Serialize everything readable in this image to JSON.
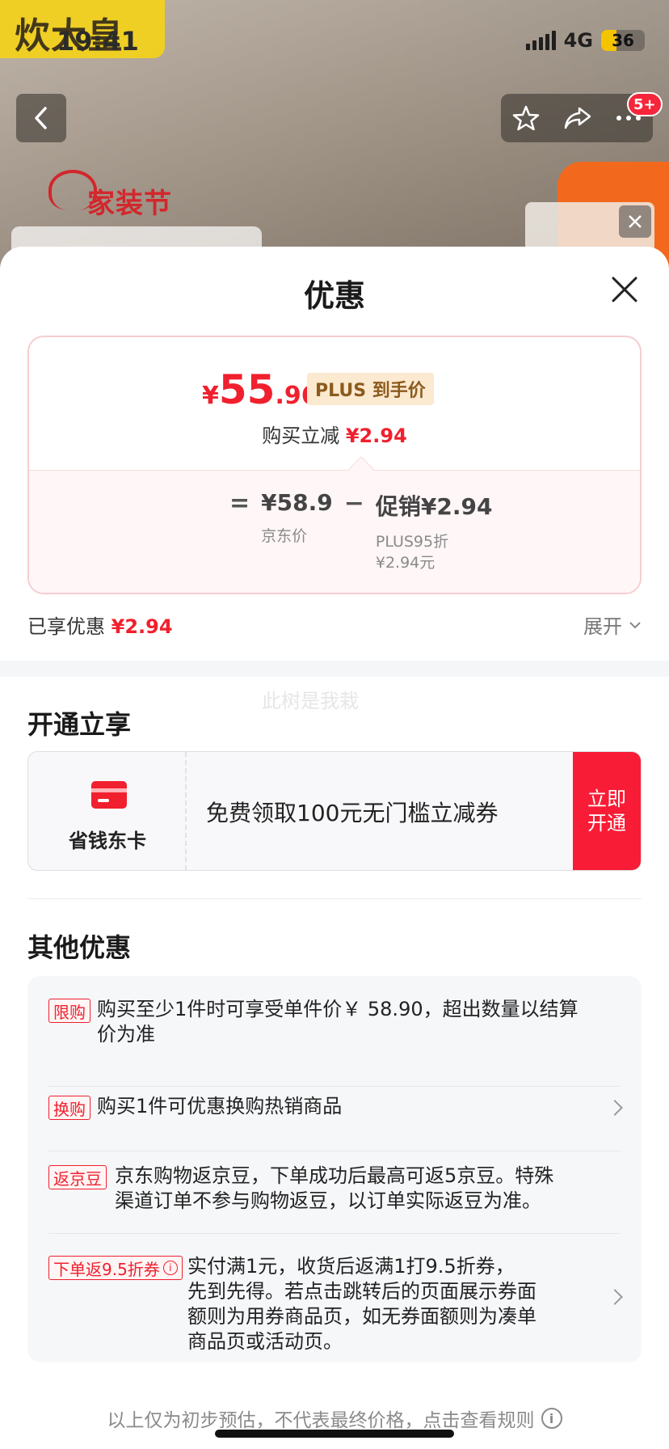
{
  "status_bar": {
    "time": "19:41",
    "network": "4G",
    "battery": "36",
    "battery_level": 0.36
  },
  "background": {
    "watermark_logo": "炊大皇",
    "promo_logo": "家装节",
    "notification_badge": "5+"
  },
  "sheet": {
    "title": "优惠",
    "price_card": {
      "final_price_symbol": "¥",
      "final_price_int": "55",
      "final_price_dec": ".96",
      "plus_tag": "PLUS 到手价",
      "reduce_label": "购买立减",
      "reduce_value": "¥2.94",
      "equals": "=",
      "jd_price_value": "¥58.9",
      "jd_price_label": "京东价",
      "minus": "−",
      "promo_value": "促销¥2.94",
      "promo_detail_1": "PLUS95折",
      "promo_detail_2": "¥2.94元"
    },
    "enjoyed_label": "已享优惠",
    "enjoyed_value": "¥2.94",
    "expand_label": "展开",
    "ghost_text": "此树是我栽",
    "open_section": {
      "title": "开通立享",
      "card_name": "省钱东卡",
      "card_desc": "免费领取100元无门槛立减券",
      "card_button": "立即开通"
    },
    "other_section": {
      "title": "其他优惠",
      "items": [
        {
          "tag": "限购",
          "text_1": "购买至少1件时可享受单件价￥ 58.90，超出数量以结算",
          "text_2": "价为准"
        },
        {
          "tag": "换购",
          "text_1": "购买1件可优惠换购热销商品"
        },
        {
          "tag": "返京豆",
          "text_1": "京东购物返京豆，下单成功后最高可返5京豆。特殊",
          "text_2": "渠道订单不参与购物返豆，以订单实际返豆为准。"
        },
        {
          "tag": "下单返9.5折券",
          "text_1": "实付满1元，收货后返满1打9.5折券，",
          "text_2": "先到先得。若点击跳转后的页面展示券面",
          "text_3": "额则为用券商品页，如无券面额则为凑单",
          "text_4": "商品页或活动页。"
        }
      ]
    },
    "footer_note": "以上仅为初步预估，不代表最终价格，点击查看规则"
  },
  "colors": {
    "accent_red": "#f0202e",
    "button_red": "#f81c36",
    "plus_gold": "#8b5a1c"
  },
  "icons": [
    "back-icon",
    "star-icon",
    "share-icon",
    "more-icon",
    "close-icon",
    "chevron-down-icon",
    "chevron-right-icon",
    "info-icon",
    "card-icon"
  ]
}
